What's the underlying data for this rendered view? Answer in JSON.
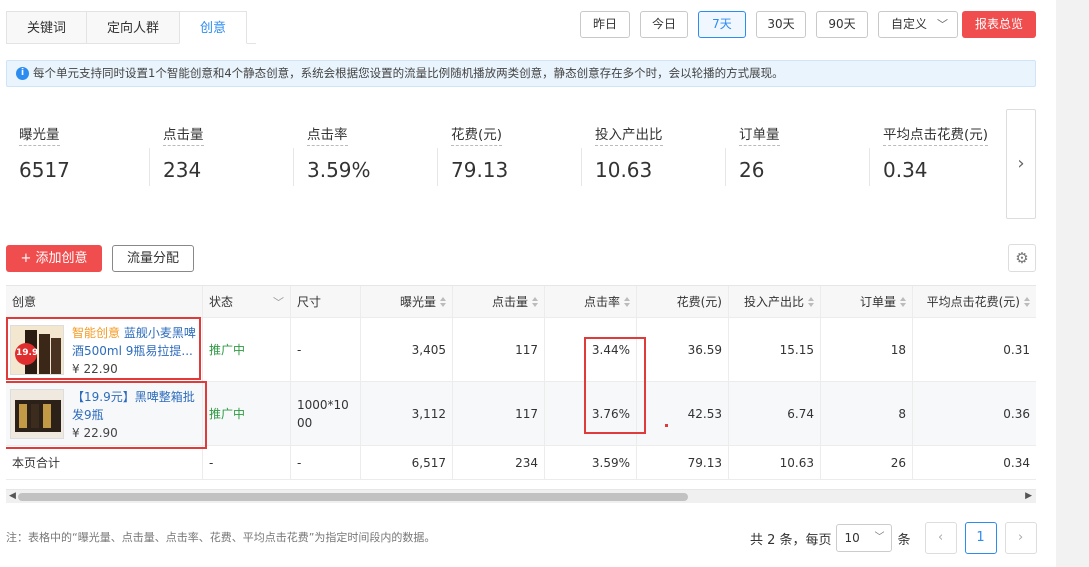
{
  "tabs": [
    {
      "label": "关键词"
    },
    {
      "label": "定向人群"
    },
    {
      "label": "创意"
    }
  ],
  "date_buttons": [
    {
      "label": "昨日"
    },
    {
      "label": "今日"
    },
    {
      "label": "7天"
    },
    {
      "label": "30天"
    },
    {
      "label": "90天"
    }
  ],
  "custom_range": {
    "label": "自定义"
  },
  "report_button": "报表总览",
  "info_text": "每个单元支持同时设置1个智能创意和4个静态创意，系统会根据您设置的流量比例随机播放两类创意，静态创意存在多个时，会以轮播的方式展现。",
  "stats": [
    {
      "label": "曝光量",
      "value": "6517"
    },
    {
      "label": "点击量",
      "value": "234"
    },
    {
      "label": "点击率",
      "value": "3.59%"
    },
    {
      "label": "花费(元)",
      "value": "79.13"
    },
    {
      "label": "投入产出比",
      "value": "10.63"
    },
    {
      "label": "订单量",
      "value": "26"
    },
    {
      "label": "平均点击花费(元)",
      "value": "0.34"
    }
  ],
  "actions": {
    "add": "+ 添加创意",
    "flow": "流量分配"
  },
  "table": {
    "headers": [
      "创意",
      "状态",
      "尺寸",
      "曝光量",
      "点击量",
      "点击率",
      "花费(元)",
      "投入产出比",
      "订单量",
      "平均点击花费(元)"
    ],
    "rows": [
      {
        "smart_tag": "智能创意",
        "title": " 蓝舰小麦黑啤酒500ml 9瓶易拉提...",
        "price": "¥ 22.90",
        "thumb_badge": "19.9",
        "status": "推广中",
        "size": "-",
        "impressions": "3,405",
        "clicks": "117",
        "ctr": "3.44%",
        "cost": "36.59",
        "roi": "15.15",
        "orders": "18",
        "cpc": "0.31"
      },
      {
        "smart_tag": "",
        "title": "【19.9元】黑啤整箱批发9瓶",
        "price": "¥ 22.90",
        "thumb_badge": "",
        "status": "推广中",
        "size": "1000*1000",
        "impressions": "3,112",
        "clicks": "117",
        "ctr": "3.76%",
        "cost": "42.53",
        "roi": "6.74",
        "orders": "8",
        "cpc": "0.36"
      }
    ],
    "total": {
      "label": "本页合计",
      "status": "-",
      "size": "-",
      "impressions": "6,517",
      "clicks": "234",
      "ctr": "3.59%",
      "cost": "79.13",
      "roi": "10.63",
      "orders": "26",
      "cpc": "0.34"
    }
  },
  "footer": {
    "note": "注：表格中的“曝光量、点击量、点击率、花费、平均点击花费”为指定时间段内的数据。",
    "total_text": "共 2 条，每页",
    "page_size": "10",
    "unit": "条",
    "current_page": "1"
  },
  "colors": {
    "accent": "#2d8cf0",
    "danger": "#f04e4e",
    "status_active": "#2e9a43",
    "smart_tag": "#f59a23"
  }
}
